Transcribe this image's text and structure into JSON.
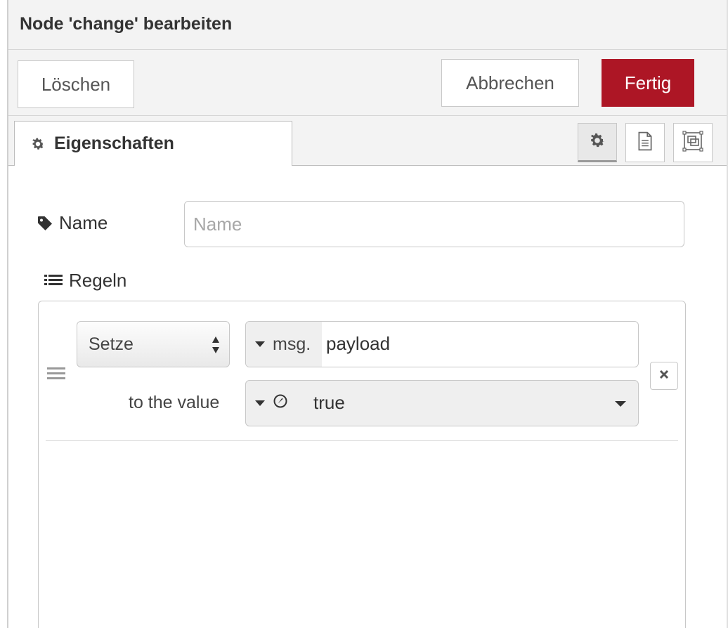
{
  "dialog": {
    "title": "Node 'change' bearbeiten"
  },
  "toolbar": {
    "delete_label": "Löschen",
    "cancel_label": "Abbrechen",
    "done_label": "Fertig",
    "done_color": "#ad1625"
  },
  "tabs": {
    "properties_label": "Eigenschaften",
    "icons": [
      "gear-icon",
      "document-icon",
      "frame-icon"
    ]
  },
  "form": {
    "name_label": "Name",
    "name_value": "",
    "name_placeholder": "Name",
    "rules_label": "Regeln"
  },
  "rules": [
    {
      "action": "Setze",
      "target_type": "msg.",
      "target_value": "payload",
      "to_label": "to the value",
      "value_type_icon": "boolean-icon",
      "value": "true"
    }
  ]
}
